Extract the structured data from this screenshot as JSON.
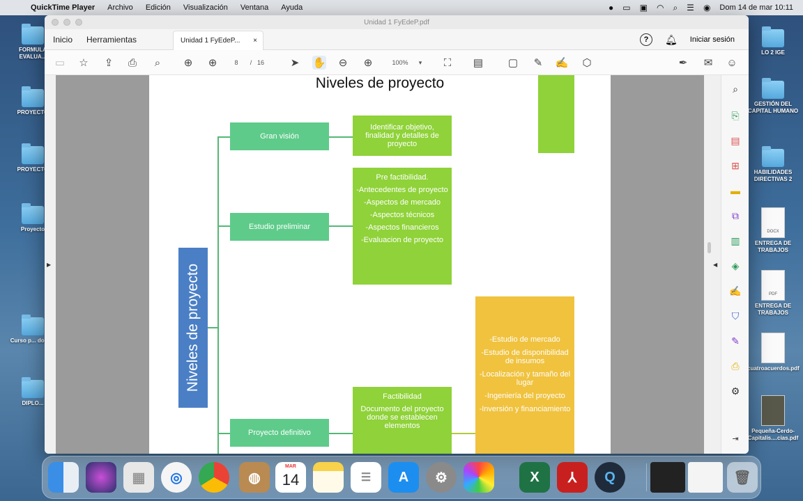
{
  "menubar": {
    "items": [
      "QuickTime Player",
      "Archivo",
      "Edición",
      "Visualización",
      "Ventana",
      "Ayuda"
    ],
    "clock": "Dom 14 de mar  10:11"
  },
  "desktop": {
    "left_icons": [
      "FORMULA EVALUA...",
      "PROYECTO",
      "PROYECTO",
      "Proyecto",
      "Curso p... doce...",
      "DIPLO..."
    ],
    "right_icons": [
      "LO 2 IGE",
      "GESTIÓN DEL CAPITAL HUMANO",
      "HABILIDADES DIRECTIVAS 2",
      "ENTREGA DE TRABAJOS",
      "ENTREGA DE TRABAJOS",
      "cuatroacuerdos.pdf",
      "Pequeña-Cerdo-Capitalis....cias.pdf"
    ],
    "doc_tags": [
      "DOCX",
      "PDF"
    ]
  },
  "window": {
    "title": "Unidad 1 FyEdeP.pdf",
    "nav_tabs": [
      "Inicio",
      "Herramientas"
    ],
    "doc_tab": "Unidad 1 FyEdeP...",
    "doc_tab_close": "×",
    "help": "?",
    "signin": "Iniciar sesión"
  },
  "toolbar": {
    "page_current": "8",
    "page_sep": "/",
    "page_total": "16",
    "zoom": "100%"
  },
  "diagram": {
    "title": "Niveles de proyecto",
    "vertical_label": "Niveles de proyecto",
    "level1": "Gran visión",
    "level1_detail": [
      "Identificar objetivo,",
      "finalidad y detalles de",
      "proyecto"
    ],
    "level2": "Estudio preliminar",
    "level2_detail": [
      "Pre factibilidad.",
      "-Antecedentes de proyecto",
      "-Aspectos de mercado",
      "-Aspectos técnicos",
      "-Aspectos financieros",
      "-Evaluacion de proyecto"
    ],
    "level3": "Proyecto definitivo",
    "level3_detail": [
      "Factibilidad",
      "Documento del proyecto donde se establecen elementos"
    ],
    "yellow_detail": [
      "-Estudio de mercado",
      "-Estudio de disponibilidad de insumos",
      "-Localización y tamaño del lugar",
      "-Ingeniería del proyecto",
      "-Inversión y financiamiento"
    ]
  },
  "dock": {
    "calendar_month": "MAR",
    "calendar_day": "14"
  },
  "colors": {
    "node_green": "#5ecb8a",
    "node_lime": "#8fd239",
    "node_yellow": "#f0c23e",
    "vertical_box": "#4a7fc5"
  }
}
